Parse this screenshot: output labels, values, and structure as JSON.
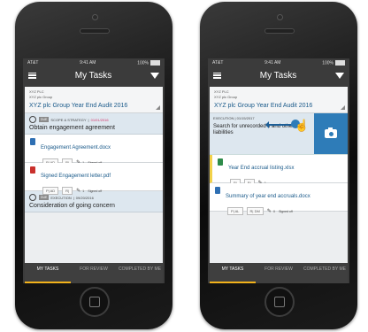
{
  "colors": {
    "accent": "#2e7cb8",
    "highlight": "#f2b21b",
    "danger": "#d6376b"
  },
  "statusbar": {
    "carrier": "AT&T",
    "time": "9:41 AM",
    "battery": "100%"
  },
  "nav": {
    "title": "My Tasks"
  },
  "header": {
    "line1": "XYZ PLC",
    "line2": "XYZ plc Group",
    "title": "XYZ plc Group Year End Audit 2016"
  },
  "phone1": {
    "section1": {
      "tag": "DUE",
      "category": "SCOPE & STRATEGY",
      "date": "01/01/2016",
      "name": "Obtain engagement agreement"
    },
    "docs": [
      {
        "name": "Engagement Agreement.docx",
        "p": "AD",
        "r": "",
        "count": "1",
        "signed": "Signed off",
        "icon": "word-icon"
      },
      {
        "name": "Signed Engagement letter.pdf",
        "p": "AD",
        "r": "",
        "count": "1",
        "signed": "Signed off",
        "icon": "pdf-icon"
      }
    ],
    "section2": {
      "tag": "DUE",
      "category": "EXECUTION",
      "date": "09/20/2016",
      "name": "Consideration of going concern"
    }
  },
  "phone2": {
    "exec": {
      "label": "EXECUTION | 01/15/2017",
      "text": "Search for unrecorded s and other liabilities"
    },
    "docs": [
      {
        "name": "Year End accrual listing.xlsx",
        "p": "",
        "r": "",
        "count": "1",
        "icon": "excel-icon"
      },
      {
        "name": "Summary of year end accruals.docx",
        "p": "AL",
        "r": "DM",
        "count": "0",
        "signed": "Signed off",
        "icon": "word-icon"
      }
    ]
  },
  "tabs": [
    {
      "label": "MY TASKS"
    },
    {
      "label": "FOR REVIEW"
    },
    {
      "label": "COMPLETED BY ME"
    }
  ]
}
